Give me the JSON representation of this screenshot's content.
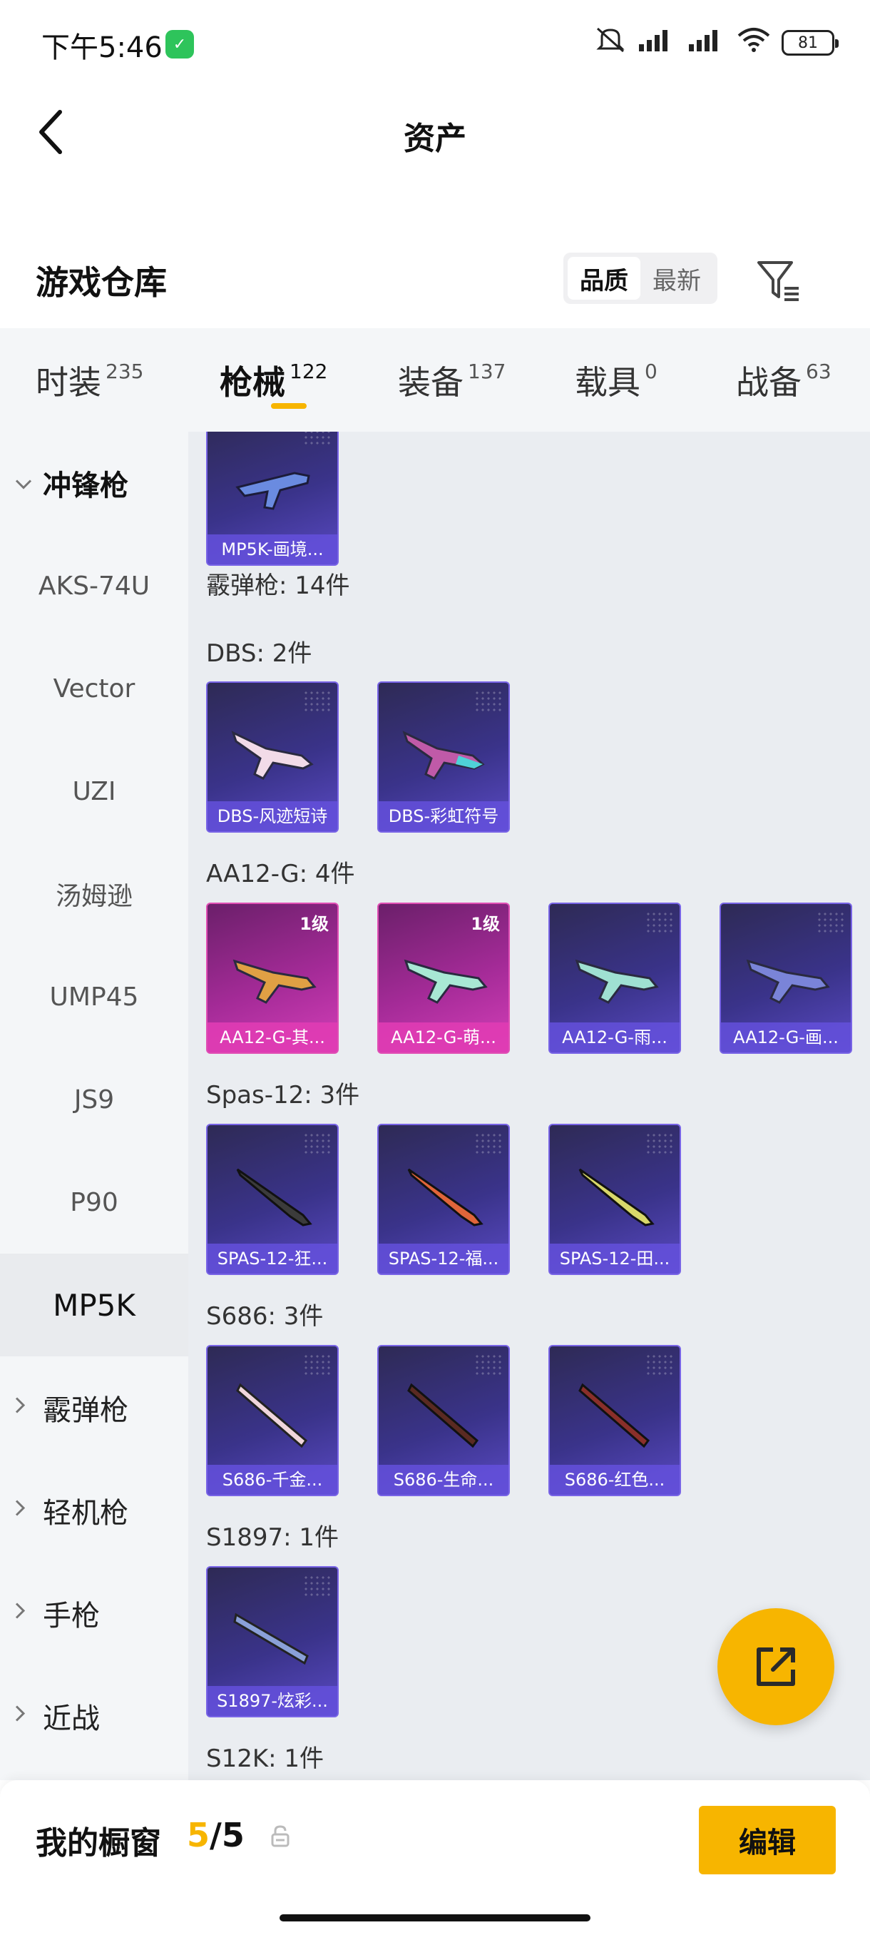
{
  "status_bar": {
    "time": "下午5:46",
    "battery": "81"
  },
  "header": {
    "title": "资产"
  },
  "warehouse": {
    "title": "游戏仓库",
    "sort_options": [
      "品质",
      "最新"
    ],
    "active_sort": "品质"
  },
  "tabs": [
    {
      "label": "时装",
      "count": "235"
    },
    {
      "label": "枪械",
      "count": "122",
      "active": true
    },
    {
      "label": "装备",
      "count": "137"
    },
    {
      "label": "载具",
      "count": "0"
    },
    {
      "label": "战备",
      "count": "63"
    }
  ],
  "sidebar": {
    "items": [
      {
        "label": "冲锋枪",
        "type": "group",
        "open": true
      },
      {
        "label": "AKS-74U"
      },
      {
        "label": "Vector"
      },
      {
        "label": "UZI"
      },
      {
        "label": "汤姆逊"
      },
      {
        "label": "UMP45"
      },
      {
        "label": "JS9"
      },
      {
        "label": "P90"
      },
      {
        "label": "MP5K",
        "selected": true
      },
      {
        "label": "霰弹枪",
        "type": "group"
      },
      {
        "label": "轻机枪",
        "type": "group"
      },
      {
        "label": "手枪",
        "type": "group"
      },
      {
        "label": "近战",
        "type": "group"
      }
    ]
  },
  "content": {
    "top_card": {
      "name": "MP5K-画境..."
    },
    "sections": [
      {
        "title": "霰弹枪: 14件",
        "cards": []
      },
      {
        "title": "DBS: 2件",
        "cards": [
          {
            "name": "DBS-风迹短诗"
          },
          {
            "name": "DBS-彩虹符号"
          }
        ]
      },
      {
        "title": "AA12-G: 4件",
        "cards": [
          {
            "name": "AA12-G-其...",
            "level": "1级",
            "pink": true
          },
          {
            "name": "AA12-G-萌...",
            "level": "1级",
            "pink": true
          },
          {
            "name": "AA12-G-雨..."
          },
          {
            "name": "AA12-G-画..."
          }
        ]
      },
      {
        "title": "Spas-12: 3件",
        "cards": [
          {
            "name": "SPAS-12-狂..."
          },
          {
            "name": "SPAS-12-福..."
          },
          {
            "name": "SPAS-12-田..."
          }
        ]
      },
      {
        "title": "S686: 3件",
        "cards": [
          {
            "name": "S686-千金..."
          },
          {
            "name": "S686-生命..."
          },
          {
            "name": "S686-红色..."
          }
        ]
      },
      {
        "title": "S1897: 1件",
        "cards": [
          {
            "name": "S1897-炫彩..."
          }
        ]
      },
      {
        "title": "S12K: 1件",
        "cards": []
      }
    ]
  },
  "bottom_bar": {
    "label": "我的橱窗",
    "current": "5",
    "total": "/5",
    "edit_label": "编辑"
  },
  "colors": {
    "accent": "#f7b500",
    "card_purple": "#3a338a",
    "card_pink": "#d43fb8"
  }
}
